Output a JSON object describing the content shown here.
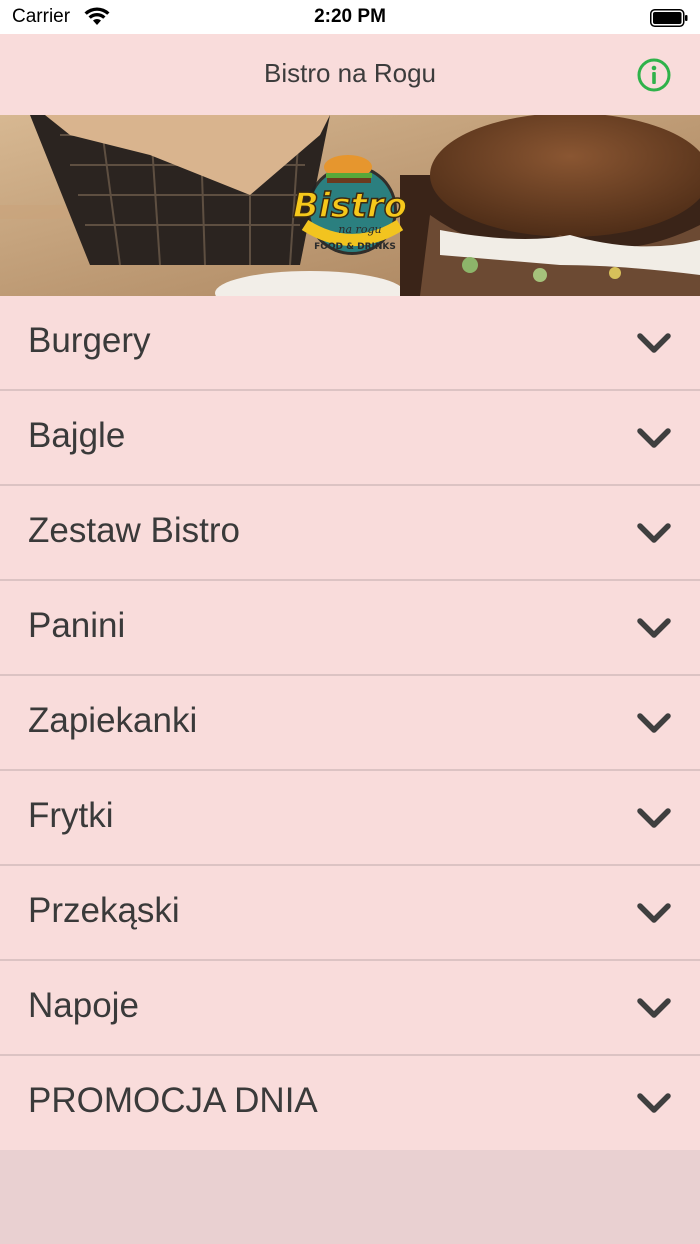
{
  "status_bar": {
    "carrier": "Carrier",
    "time": "2:20 PM"
  },
  "nav": {
    "title": "Bistro na Rogu",
    "info_icon": "info-icon",
    "info_color": "#2fb24a"
  },
  "hero": {
    "logo_text": "Bistro",
    "logo_subtext": "na rogu",
    "logo_tagline": "FOOD & DRINKS"
  },
  "menu": {
    "items": [
      {
        "label": "Burgery"
      },
      {
        "label": "Bajgle"
      },
      {
        "label": "Zestaw Bistro"
      },
      {
        "label": "Panini"
      },
      {
        "label": "Zapiekanki"
      },
      {
        "label": "Frytki"
      },
      {
        "label": "Przekąski"
      },
      {
        "label": "Napoje"
      },
      {
        "label": "PROMOCJA DNIA"
      }
    ],
    "chevron_icon": "chevron-down-icon"
  },
  "colors": {
    "nav_bg": "#f9dcdb",
    "row_bg": "#f9dcdb",
    "footer_bg": "#e9d0d1",
    "text": "#3a3a3a"
  }
}
